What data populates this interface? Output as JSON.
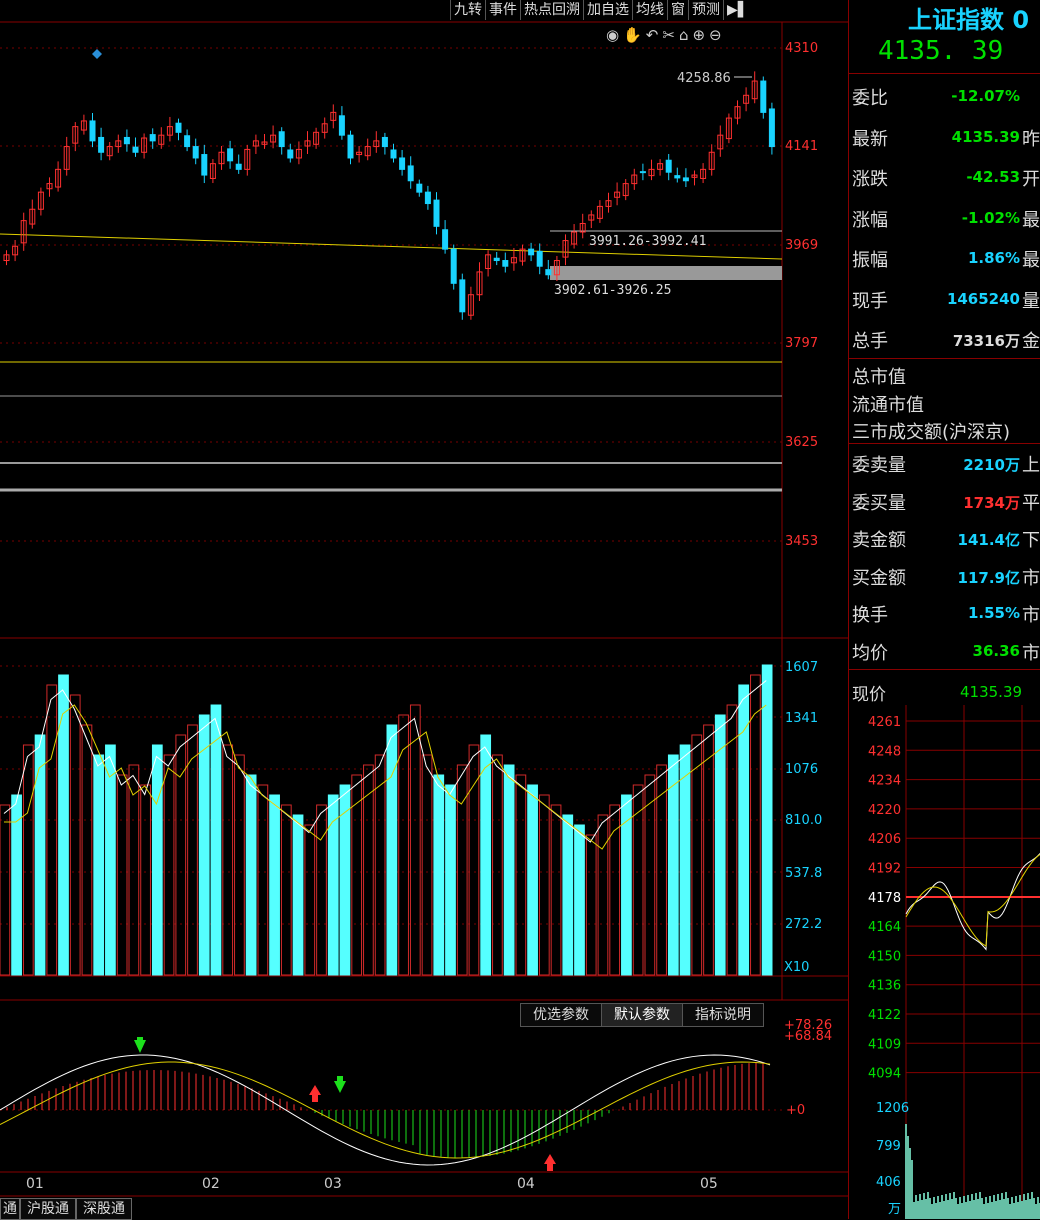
{
  "toolbar": {
    "items": [
      "九转",
      "事件",
      "热点回溯",
      "加自选",
      "均线",
      "窗",
      "预测",
      "▶▌"
    ]
  },
  "icons": [
    "eye-icon",
    "hand-icon",
    "undo-icon",
    "scissors-icon",
    "lock-icon",
    "zoom-in-icon",
    "zoom-out-icon"
  ],
  "main_chart": {
    "y_labels": [
      "4310",
      "4141",
      "3969",
      "3797",
      "3625",
      "3453"
    ],
    "high_label": "4258.86",
    "gap_upper_label": "3991.26-3992.41",
    "gap_lower_label": "3902.61-3926.25"
  },
  "volume_chart": {
    "y_labels": [
      "1607",
      "1341",
      "1076",
      "810.0",
      "537.8",
      "272.2"
    ],
    "unit": "X10"
  },
  "macd_chart": {
    "y_labels": [
      "+78.26",
      "+68.84",
      "+0"
    ],
    "tabs": [
      "优选参数",
      "默认参数",
      "指标说明"
    ],
    "active_tab": "默认参数"
  },
  "x_labels": [
    "01",
    "02",
    "03",
    "04",
    "05"
  ],
  "bottom_tabs": [
    "通",
    "沪股通",
    "深股通"
  ],
  "quote": {
    "title": "上证指数 0",
    "price": "4135. 39",
    "rows": [
      {
        "label": "委比",
        "value": "-12.07%",
        "color": "#00e000",
        "ext": ""
      },
      {
        "label": "最新",
        "value": "4135.39",
        "color": "#00e000",
        "ext": "昨"
      },
      {
        "label": "涨跌",
        "value": "-42.53",
        "color": "#00e000",
        "ext": "开"
      },
      {
        "label": "涨幅",
        "value": "-1.02%",
        "color": "#00e000",
        "ext": "最"
      },
      {
        "label": "振幅",
        "value": "1.86%",
        "color": "#19d3ff",
        "ext": "最"
      },
      {
        "label": "现手",
        "value": "1465240",
        "color": "#19d3ff",
        "ext": "量"
      },
      {
        "label": "总手",
        "value": "73316万",
        "color": "#ddd",
        "ext": "金"
      }
    ],
    "plain_rows": [
      "总市值",
      "流通市值",
      "三市成交额(沪深京)"
    ],
    "rows2": [
      {
        "label": "委卖量",
        "value": "2210万",
        "color": "#19d3ff",
        "ext": "上"
      },
      {
        "label": "委买量",
        "value": "1734万",
        "color": "#ff3030",
        "ext": "平"
      },
      {
        "label": "卖金额",
        "value": "141.4亿",
        "color": "#19d3ff",
        "ext": "下"
      },
      {
        "label": "买金额",
        "value": "117.9亿",
        "color": "#19d3ff",
        "ext": "市"
      },
      {
        "label": "换手",
        "value": "1.55%",
        "color": "#19d3ff",
        "ext": "市"
      },
      {
        "label": "均价",
        "value": "36.36",
        "color": "#00e000",
        "ext": "市"
      }
    ],
    "now_label": "现价",
    "now_value": "4135.39"
  },
  "intraday": {
    "y_labels": [
      "4261",
      "4248",
      "4234",
      "4220",
      "4206",
      "4192",
      "4178",
      "4164",
      "4150",
      "4136",
      "4122",
      "4109",
      "4094"
    ],
    "vol_labels": [
      "1206",
      "799",
      "406",
      "万"
    ]
  }
}
